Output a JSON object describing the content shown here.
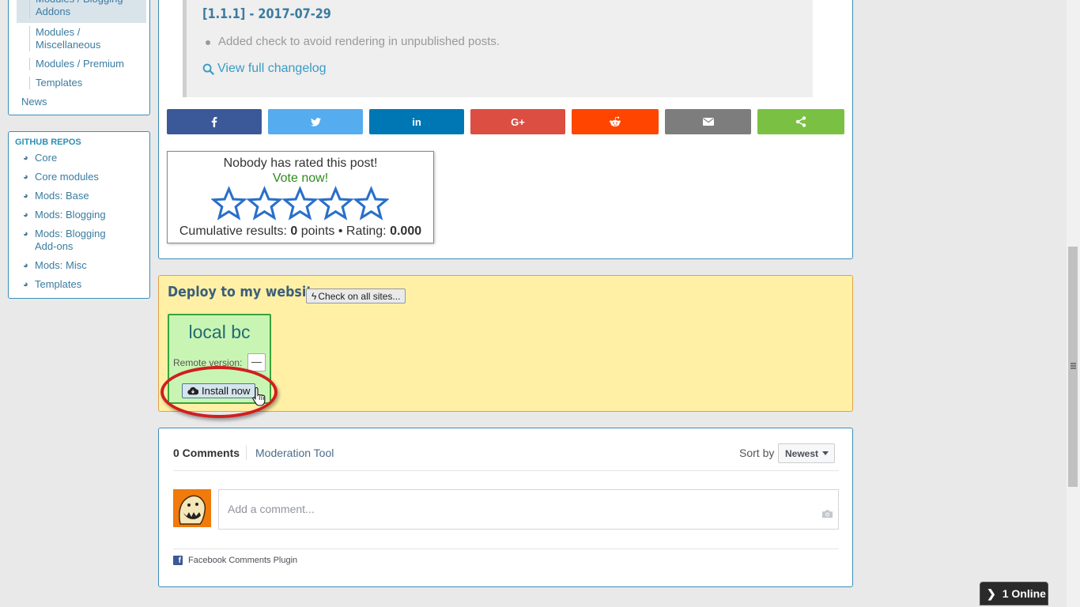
{
  "sidebar": {
    "categories": [
      {
        "label": "Modules / Blogging Addons"
      },
      {
        "label": "Modules / Miscellaneous"
      },
      {
        "label": "Modules / Premium"
      },
      {
        "label": "Templates"
      }
    ],
    "news_label": "News",
    "repos_title": "GITHUB REPOS",
    "repos": [
      {
        "label": "Core"
      },
      {
        "label": "Core modules"
      },
      {
        "label": "Mods: Base"
      },
      {
        "label": "Mods: Blogging"
      },
      {
        "label": "Mods: Blogging Add-ons"
      },
      {
        "label": "Mods: Misc"
      },
      {
        "label": "Templates"
      }
    ]
  },
  "changelog": {
    "version": "[1.1.1] - 2017-07-29",
    "note": "Added check to avoid rendering in unpublished posts.",
    "full_link": "View full changelog"
  },
  "share": {
    "colors": {
      "facebook": "#3b5998",
      "twitter": "#55acee",
      "linkedin": "#0077b5",
      "googleplus": "#dc4e41",
      "reddit": "#ff4500",
      "email": "#7d7d7d",
      "sharethis": "#7ac143"
    },
    "icons": [
      "facebook-icon",
      "twitter-icon",
      "linkedin-icon",
      "google-plus-icon",
      "reddit-icon",
      "email-icon",
      "share-icon"
    ],
    "gplus_glyph": "G+",
    "linkedin_glyph": "in"
  },
  "rating": {
    "headline": "Nobody has rated this post!",
    "cta": "Vote now!",
    "results_prefix": "Cumulative results:",
    "points": "0",
    "points_label": "points •",
    "rating_label": "Rating:",
    "rating_value": "0.000",
    "stars_filled": 0,
    "stars_total": 5
  },
  "deploy": {
    "title": "Deploy to my websites",
    "check_button": "Check on all sites...",
    "site": {
      "name": "local bc",
      "remote_label": "Remote version:",
      "remote_value": "—",
      "install_button": "Install now"
    },
    "colors": {
      "background": "#fff0a6",
      "card": "#c9f5b4",
      "highlight": "#cf1f1f"
    }
  },
  "comments": {
    "count_label": "0 Comments",
    "moderation": "Moderation Tool",
    "sort_label": "Sort by",
    "sort_value": "Newest",
    "placeholder": "Add a comment...",
    "plugin_label": "Facebook Comments Plugin"
  },
  "online": {
    "label": "1 Online"
  }
}
